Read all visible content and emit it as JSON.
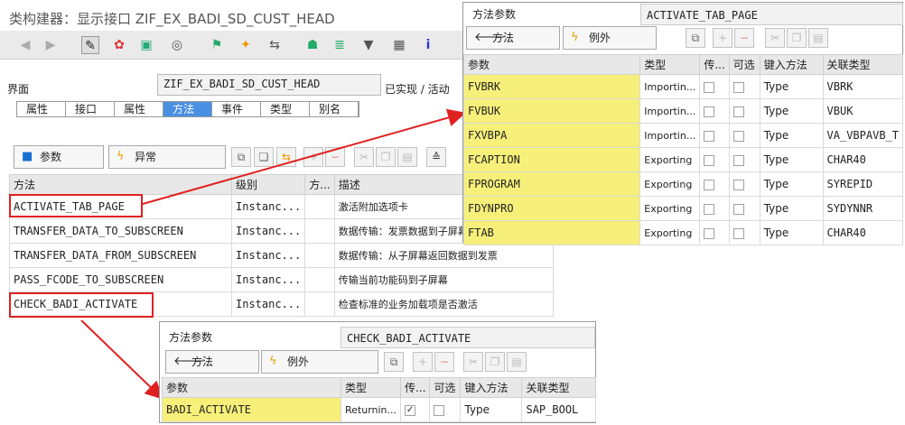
{
  "main": {
    "title": "类构建器：显示接口 ZIF_EX_BADI_SD_CUST_HEAD",
    "interface_label": "界面",
    "interface_value": "ZIF_EX_BADI_SD_CUST_HEAD",
    "status": "已实现 / 活动",
    "tabs": [
      "属性",
      "接口",
      "属性",
      "方法",
      "事件",
      "类型",
      "别名"
    ],
    "active_tab": "方法",
    "btn_params": "参数",
    "btn_exceptions": "异常",
    "columns": [
      "方法",
      "级别",
      "方...",
      "描述"
    ],
    "rows": [
      {
        "name": "ACTIVATE_TAB_PAGE",
        "level": "Instanc...",
        "desc": "激活附加选项卡"
      },
      {
        "name": "TRANSFER_DATA_TO_SUBSCREEN",
        "level": "Instanc...",
        "desc": "数据传输：发票数据到子屏幕"
      },
      {
        "name": "TRANSFER_DATA_FROM_SUBSCREEN",
        "level": "Instanc...",
        "desc": "数据传输：从子屏幕返回数据到发票"
      },
      {
        "name": "PASS_FCODE_TO_SUBSCREEN",
        "level": "Instanc...",
        "desc": "传输当前功能码到子屏幕"
      },
      {
        "name": "CHECK_BADI_ACTIVATE",
        "level": "Instanc...",
        "desc": "检查标准的业务加载项是否激活"
      }
    ]
  },
  "params1": {
    "label": "方法参数",
    "method": "ACTIVATE_TAB_PAGE",
    "btn_method": "方法",
    "btn_exceptions": "例外",
    "columns": [
      "参数",
      "类型",
      "传...",
      "可选",
      "键入方法",
      "关联类型"
    ],
    "rows": [
      {
        "name": "FVBRK",
        "type": "Importin...",
        "typing": "Type",
        "ref": "VBRK"
      },
      {
        "name": "FVBUK",
        "type": "Importin...",
        "typing": "Type",
        "ref": "VBUK"
      },
      {
        "name": "FXVBPA",
        "type": "Importin...",
        "typing": "Type",
        "ref": "VA_VBPAVB_T"
      },
      {
        "name": "FCAPTION",
        "type": "Exporting",
        "typing": "Type",
        "ref": "CHAR40"
      },
      {
        "name": "FPROGRAM",
        "type": "Exporting",
        "typing": "Type",
        "ref": "SYREPID"
      },
      {
        "name": "FDYNPRO",
        "type": "Exporting",
        "typing": "Type",
        "ref": "SYDYNNR"
      },
      {
        "name": "FTAB",
        "type": "Exporting",
        "typing": "Type",
        "ref": "CHAR40"
      }
    ]
  },
  "params2": {
    "label": "方法参数",
    "method": "CHECK_BADI_ACTIVATE",
    "btn_method": "方法",
    "btn_exceptions": "例外",
    "columns": [
      "参数",
      "类型",
      "传...",
      "可选",
      "键入方法",
      "关联类型"
    ],
    "rows": [
      {
        "name": "BADI_ACTIVATE",
        "type": "Returnin...",
        "pass_value": "✓",
        "typing": "Type",
        "ref": "SAP_BOOL"
      }
    ]
  },
  "colors": {
    "highlight": "#f6f07a",
    "arrow": "#e02020",
    "active_tab": "#4a90e2"
  }
}
